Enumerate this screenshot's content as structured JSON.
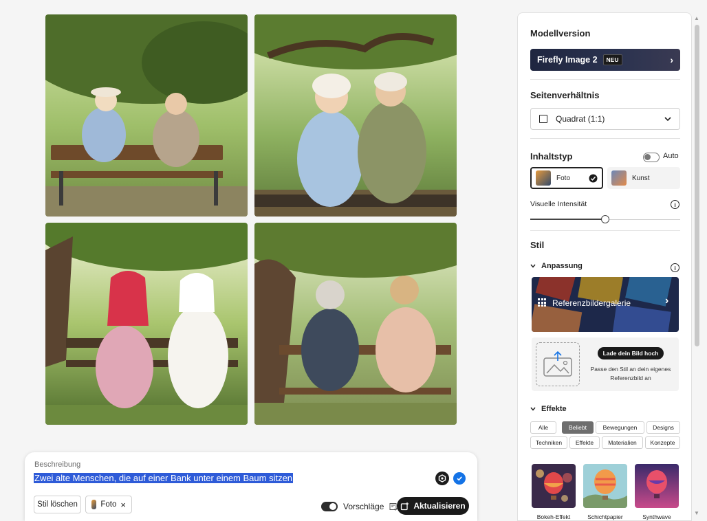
{
  "images": [
    {
      "name": "image-result-1",
      "alt": ""
    },
    {
      "name": "image-result-2",
      "alt": ""
    },
    {
      "name": "image-result-3",
      "alt": ""
    },
    {
      "name": "image-result-4",
      "alt": ""
    }
  ],
  "prompt": {
    "label": "Beschreibung",
    "text": "Zwei alte Menschen, die auf einer Bank unter einem Baum sitzen",
    "clear_style_label": "Stil löschen",
    "chip_label": "Foto",
    "chip_close": "×",
    "suggestions_label": "Vorschläge",
    "update_label": "Aktualisieren"
  },
  "panel": {
    "model_title": "Modellversion",
    "model_name": "Firefly Image 2",
    "model_badge": "NEU",
    "aspect_title": "Seitenverhältnis",
    "aspect_value": "Quadrat (1:1)",
    "content_title": "Inhaltstyp",
    "auto_label": "Auto",
    "content_photo": "Foto",
    "content_art": "Kunst",
    "intensity_label": "Visuelle Intensität",
    "intensity_value": 0.5,
    "style_title": "Stil",
    "customize_label": "Anpassung",
    "gallery_label": "Referenzbildergalerie",
    "upload_button": "Lade dein Bild hoch",
    "upload_hint": "Passe den Stil an dein eigenes Referenzbild an",
    "effects_label": "Effekte",
    "filters": [
      "Alle",
      "Beliebt",
      "Bewegungen",
      "Designs",
      "Techniken",
      "Effekte",
      "Materialien",
      "Konzepte"
    ],
    "active_filter": "Beliebt",
    "effects": [
      "Bokeh-Effekt",
      "Schichtpapier",
      "Synthwave"
    ]
  },
  "colors": {
    "accent_blue": "#1473e6",
    "selection_blue": "#2e5bd8",
    "dark": "#1a1a1a"
  }
}
